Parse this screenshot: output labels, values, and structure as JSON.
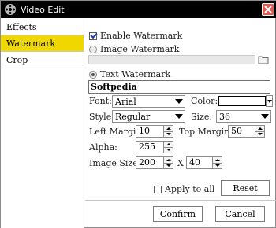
{
  "window": {
    "title": "Video Edit"
  },
  "sidebar": {
    "items": [
      {
        "label": "Effects",
        "active": false
      },
      {
        "label": "Watermark",
        "active": true
      },
      {
        "label": "Crop",
        "active": false
      }
    ]
  },
  "watermark": {
    "enable_label": "Enable Watermark",
    "enable_checked": true,
    "image_label": "Image Watermark",
    "image_path": "",
    "text_label": "Text Watermark",
    "text_value": "Softpedia",
    "font_label": "Font:",
    "font_value": "Arial",
    "color_label": "Color:",
    "color_value": "#ffffff",
    "style_label": "Style:",
    "style_value": "Regular",
    "size_label": "Size:",
    "size_value": "36",
    "left_margin_label": "Left Margin:",
    "left_margin_value": "10",
    "top_margin_label": "Top Margin:",
    "top_margin_value": "50",
    "alpha_label": "Alpha:",
    "alpha_value": "255",
    "image_size_label": "Image Size:",
    "image_width": "200",
    "image_x": "X",
    "image_height": "40",
    "apply_all_label": "Apply to all",
    "apply_all_checked": false,
    "reset_label": "Reset"
  },
  "footer": {
    "confirm_label": "Confirm",
    "cancel_label": "Cancel"
  },
  "colors": {
    "titlebar": "#000000",
    "active_tab": "#f0d700",
    "close_button": "#e05a4e"
  }
}
